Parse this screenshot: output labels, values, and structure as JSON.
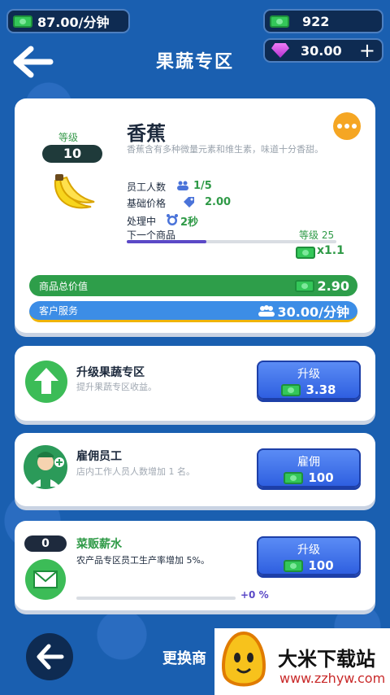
{
  "hud": {
    "income": "87.00/分钟",
    "cash": "922",
    "gems": "30.00",
    "plus": "+"
  },
  "page_title": "果蔬专区",
  "product": {
    "level_label": "等级",
    "level": "10",
    "name": "香蕉",
    "description": "香蕉含有多种微量元素和维生素，味道十分香甜。",
    "staff_label": "员工人数",
    "staff": "1/5",
    "price_label": "基础价格",
    "price": "2.00",
    "processing_label": "处理中",
    "processing_time": "2秒",
    "next_label": "下一个商品",
    "next_level": "等级 25",
    "multiplier": "x1.1",
    "next_progress": 0.38
  },
  "bars": {
    "total_label": "商品总价值",
    "total": "2.90",
    "service_label": "客户服务",
    "service": "30.00/分钟"
  },
  "upgrades": [
    {
      "title": "升级果蔬专区",
      "sub": "提升果蔬专区收益。",
      "btn": "升级",
      "cost": "3.38"
    },
    {
      "title": "雇佣员工",
      "sub": "店内工作人员人数增加 1 名。",
      "btn": "雇佣",
      "cost": "100"
    },
    {
      "level": "0",
      "title": "菜贩薪水",
      "sub": "农产品专区员工生产率增加 5%。",
      "btn": "升级",
      "cost": "100",
      "bonus": "+0 %"
    }
  ],
  "bottom": {
    "switch_label": "更换商"
  },
  "watermark": {
    "brand": "大米下载站",
    "url": "www.zzhyw.com"
  }
}
